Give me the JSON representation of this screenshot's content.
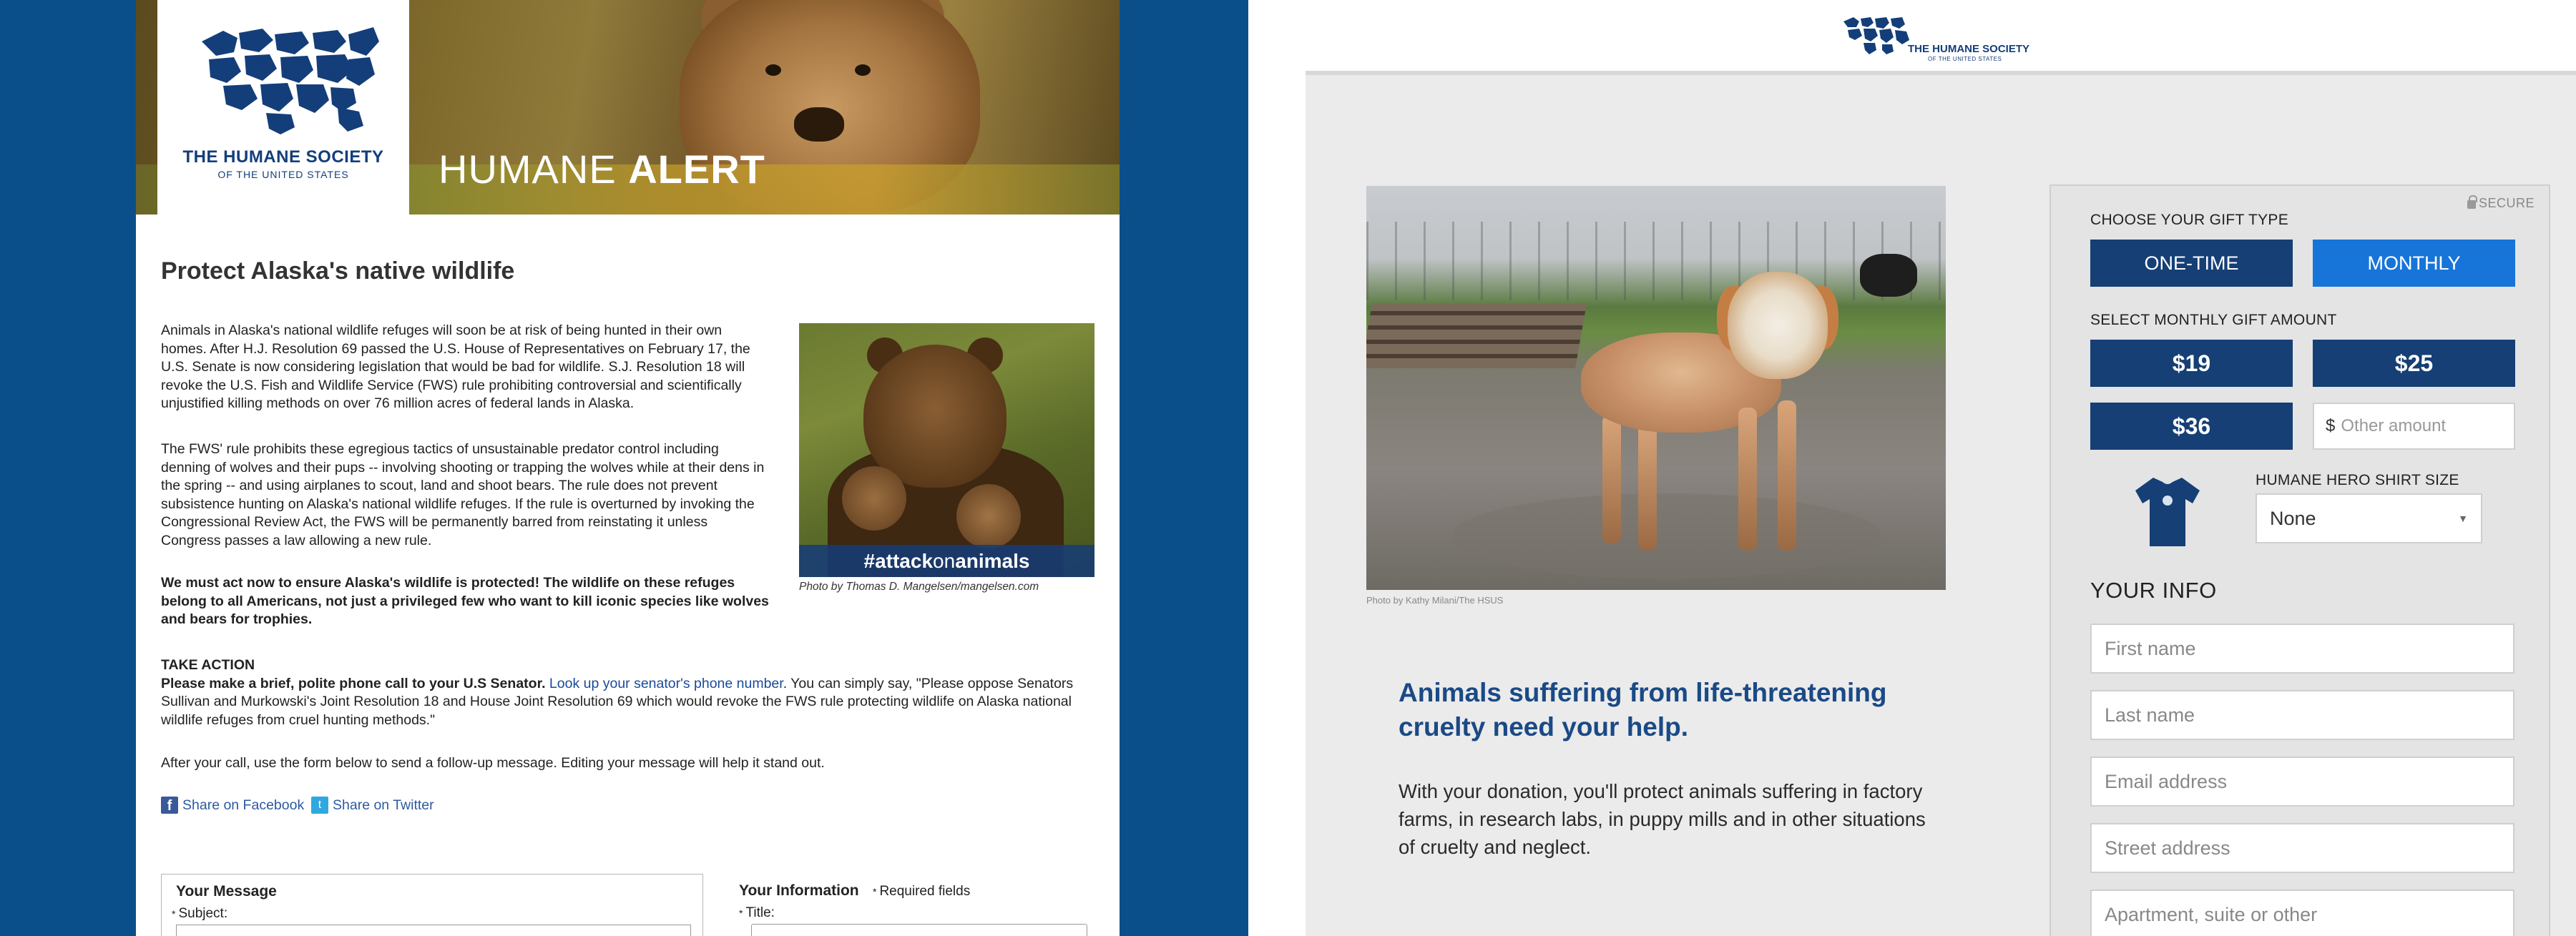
{
  "left": {
    "logo": {
      "name": "THE HUMANE SOCIETY",
      "sub": "OF THE UNITED STATES"
    },
    "banner": {
      "title_light": "HUMANE ",
      "title_bold": "ALERT"
    },
    "heading": "Protect Alaska's native wildlife",
    "p1": "Animals in Alaska's national wildlife refuges will soon be at risk of being hunted in their own homes. After H.J. Resolution 69 passed the U.S. House of Representatives on February 17, the U.S. Senate is now considering legislation that would be bad for wildlife. S.J. Resolution 18 will revoke the U.S. Fish and Wildlife Service (FWS) rule prohibiting controversial and scientifically unjustified killing methods on over 76 million acres of federal lands in Alaska.",
    "p2": "The FWS' rule prohibits these egregious tactics of unsustainable predator control including denning of wolves and their pups -- involving shooting or trapping the wolves while at their dens in the spring -- and using airplanes to scout, land and shoot bears. The rule does not prevent subsistence hunting on Alaska's national wildlife refuges. If the rule is overturned by invoking the Congressional Review Act, the FWS will be permanently barred from reinstating it unless Congress passes a law allowing a new rule.",
    "p3": "We must act now to ensure Alaska's wildlife is protected! The wildlife on these refuges belong to all Americans, not just a privileged few who want to kill iconic species like wolves and bears for trophies.",
    "take_action": {
      "head": "TAKE ACTION",
      "strong": "Please make a brief, polite phone call to your U.S Senator.",
      "link": "Look up your senator's phone number",
      "rest": ". You can simply say, \"Please oppose Senators Sullivan and Murkowski's Joint Resolution 18 and House Joint Resolution 69 which would revoke the FWS rule protecting wildlife on Alaska national wildlife refuges from cruel hunting methods.\""
    },
    "p4": "After your call, use the form below to send a follow-up message. Editing your message will help it stand out.",
    "share_fb": "Share on Facebook",
    "share_tw": "Share on Twitter",
    "photo": {
      "tag_a": "#attack",
      "tag_b": "on",
      "tag_c": "animals",
      "credit": "Photo by Thomas D. Mangelsen/mangelsen.com"
    },
    "form": {
      "message_title": "Your Message",
      "subject_label": "Subject:",
      "info_title": "Your Information",
      "required_note": "Required fields",
      "title_label": "Title:",
      "star": "*"
    }
  },
  "right": {
    "logo": {
      "name": "THE HUMANE SOCIETY",
      "sub": "OF THE UNITED STATES"
    },
    "photo_credit": "Photo by Kathy Milani/The HSUS",
    "appeal_head": "Animals suffering from life-threatening cruelty need your help.",
    "appeal_body": "With your donation, you'll protect animals suffering in factory farms, in research labs, in puppy mills and in other situations of cruelty and neglect.",
    "form": {
      "secure": "SECURE",
      "gift_type_label": "CHOOSE YOUR GIFT TYPE",
      "one_time": "ONE-TIME",
      "monthly": "MONTHLY",
      "amount_label": "SELECT MONTHLY GIFT AMOUNT",
      "amounts": [
        "$19",
        "$25",
        "$36"
      ],
      "currency": "$",
      "other_placeholder": "Other amount",
      "shirt_label": "HUMANE HERO SHIRT SIZE",
      "shirt_size": "None",
      "your_info": "YOUR INFO",
      "fields": [
        "First name",
        "Last name",
        "Email address",
        "Street address",
        "Apartment, suite or other"
      ]
    }
  },
  "colors": {
    "brand_navy": "#153f75",
    "accent_blue": "#1775d9",
    "left_bg": "#0b4f8a"
  }
}
